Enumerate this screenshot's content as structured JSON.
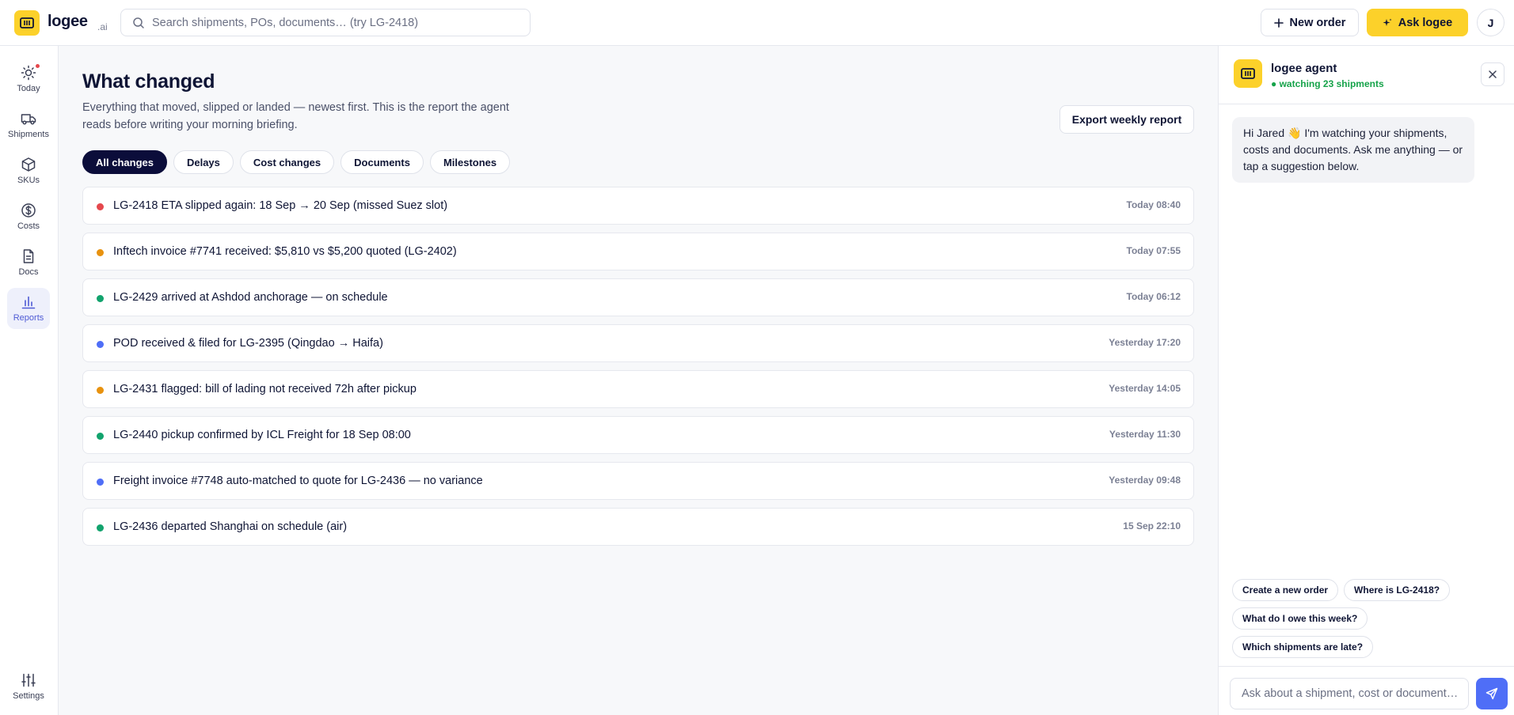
{
  "topbar": {
    "brand": "logee",
    "brand_suffix": ".ai",
    "search_placeholder": "Search shipments, POs, documents… (try LG-2418)",
    "new_order_label": "New order",
    "ask_label": "Ask logee",
    "avatar_initial": "J"
  },
  "sidebar": {
    "items": [
      {
        "label": "Today",
        "icon": "sun-icon"
      },
      {
        "label": "Shipments",
        "icon": "truck-icon"
      },
      {
        "label": "SKUs",
        "icon": "box-icon"
      },
      {
        "label": "Costs",
        "icon": "dollar-icon"
      },
      {
        "label": "Docs",
        "icon": "document-icon"
      },
      {
        "label": "Reports",
        "icon": "bar-chart-icon",
        "active": true
      }
    ],
    "settings_label": "Settings"
  },
  "main": {
    "title": "What changed",
    "subtitle": "Everything that moved, slipped or landed — newest first. This is the report the agent reads before writing your morning briefing.",
    "export_label": "Export weekly report",
    "filters": [
      "All changes",
      "Delays",
      "Cost changes",
      "Documents",
      "Milestones"
    ],
    "active_filter": "All changes",
    "changes": [
      {
        "text": "LG-2418 ETA slipped again: 18 Sep → 20 Sep (missed Suez slot)",
        "time": "Today 08:40",
        "color": "#e5484d"
      },
      {
        "text": "Inftech invoice #7741 received: $5,810 vs $5,200 quoted (LG-2402)",
        "time": "Today 07:55",
        "color": "#e8920f"
      },
      {
        "text": "LG-2429 arrived at Ashdod anchorage — on schedule",
        "time": "Today 06:12",
        "color": "#12a36d"
      },
      {
        "text": "POD received & filed for LG-2395 (Qingdao → Haifa)",
        "time": "Yesterday 17:20",
        "color": "#4f6ef7"
      },
      {
        "text": "LG-2431 flagged: bill of lading not received 72h after pickup",
        "time": "Yesterday 14:05",
        "color": "#e8920f"
      },
      {
        "text": "LG-2440 pickup confirmed by ICL Freight for 18 Sep 08:00",
        "time": "Yesterday 11:30",
        "color": "#12a36d"
      },
      {
        "text": "Freight invoice #7748 auto-matched to quote for LG-2436 — no variance",
        "time": "Yesterday 09:48",
        "color": "#4f6ef7"
      },
      {
        "text": "LG-2436 departed Shanghai on schedule (air)",
        "time": "15 Sep 22:10",
        "color": "#12a36d"
      }
    ]
  },
  "agent": {
    "name": "logee agent",
    "status": "● watching 23 shipments",
    "greeting": "Hi Jared 👋 I'm watching your shipments, costs and documents. Ask me anything — or tap a suggestion below.",
    "suggestions": [
      "Create a new order",
      "Where is LG-2418?",
      "What do I owe this week?",
      "Which shipments are late?"
    ],
    "input_placeholder": "Ask about a shipment, cost or document…"
  }
}
